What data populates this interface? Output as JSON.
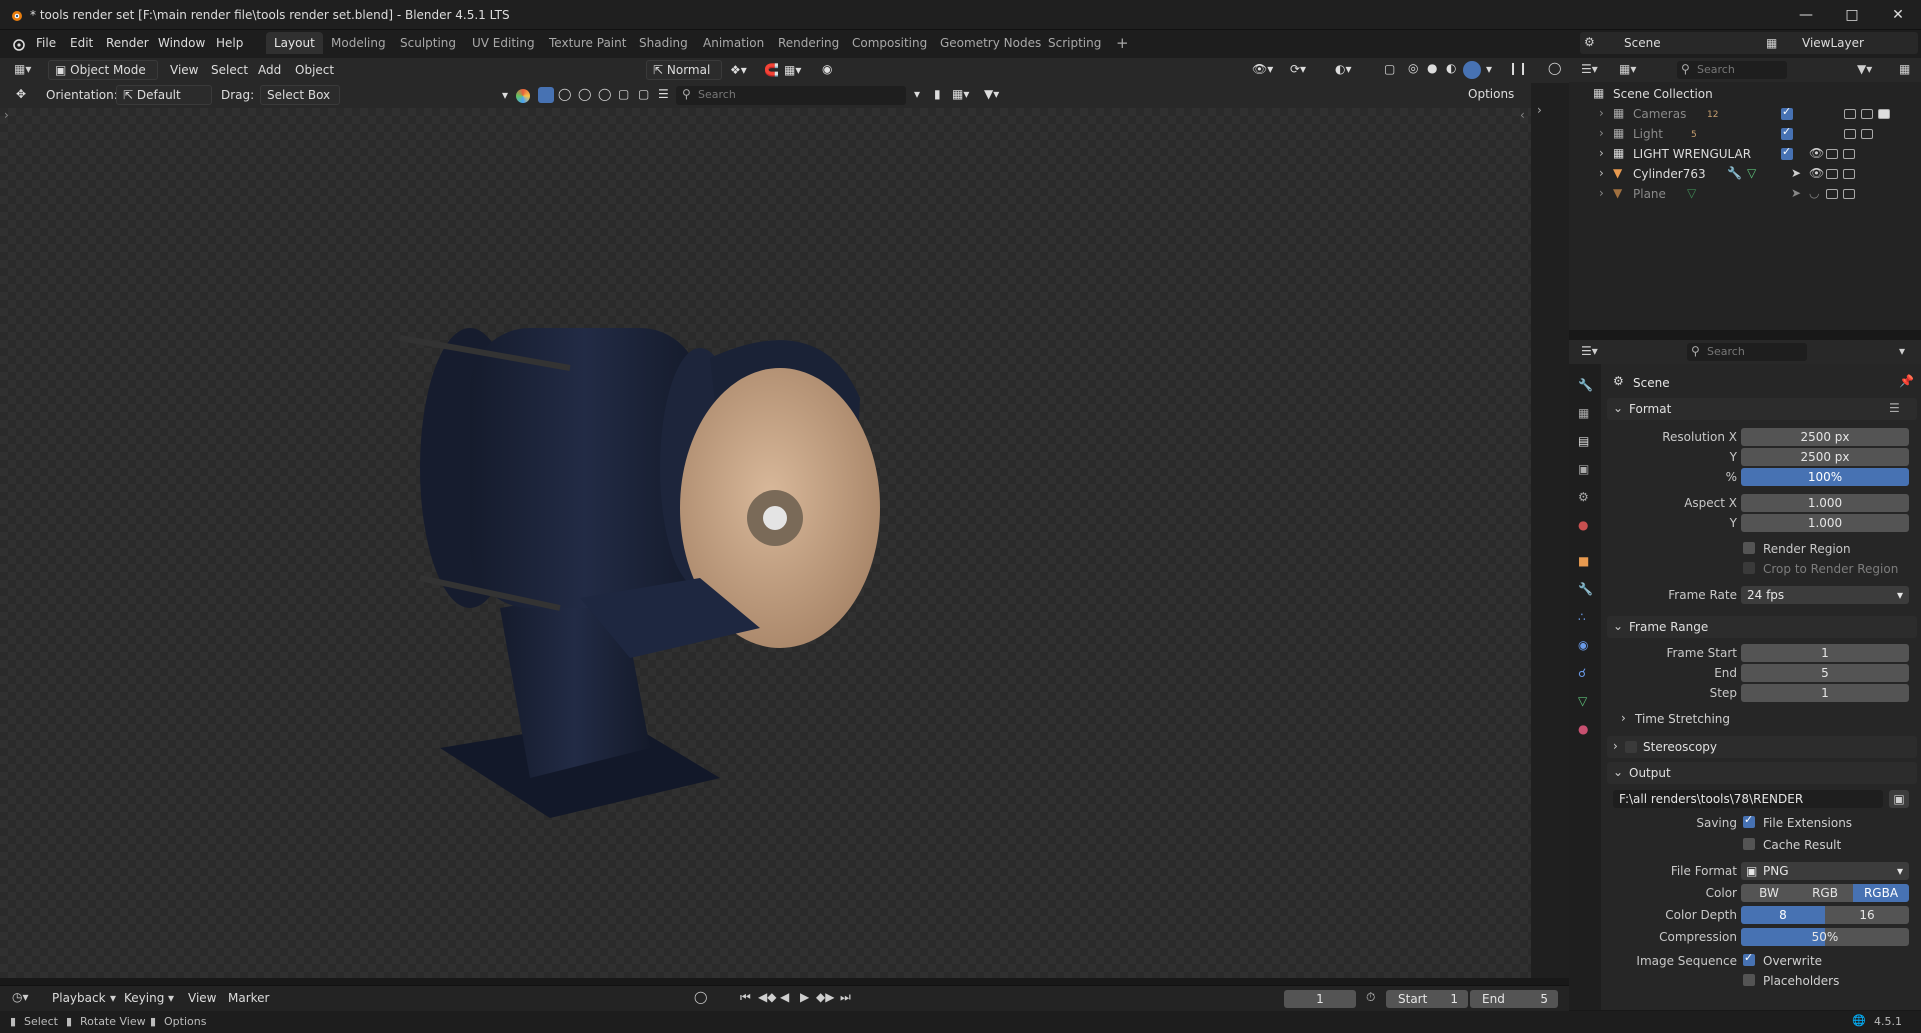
{
  "window": {
    "title": "* tools render set [F:\\main render file\\tools render set.blend] - Blender 4.5.1 LTS"
  },
  "menu": [
    "File",
    "Edit",
    "Render",
    "Window",
    "Help"
  ],
  "workspace_tabs": [
    "Layout",
    "Modeling",
    "Sculpting",
    "UV Editing",
    "Texture Paint",
    "Shading",
    "Animation",
    "Rendering",
    "Compositing",
    "Geometry Nodes",
    "Scripting"
  ],
  "scene_selector": {
    "scene": "Scene",
    "view_layer": "ViewLayer"
  },
  "viewport_header": {
    "mode": "Object Mode",
    "menus": [
      "View",
      "Select",
      "Add",
      "Object"
    ],
    "transform_orientation": "Normal",
    "orientation_label": "Orientation:",
    "orientation_value": "Default",
    "drag_label": "Drag:",
    "drag_value": "Select Box",
    "search_placeholder": "Search",
    "options_label": "Options"
  },
  "outliner": {
    "search_placeholder": "Search",
    "root": "Scene Collection",
    "items": [
      {
        "name": "Cameras",
        "badge": "12",
        "dim": true
      },
      {
        "name": "Light",
        "badge": "5",
        "dim": true
      },
      {
        "name": "LIGHT WRENGULAR",
        "badge": "",
        "dim": false
      },
      {
        "name": "Cylinder763",
        "badge": "",
        "dim": false
      },
      {
        "name": "Plane",
        "badge": "",
        "dim": true
      }
    ]
  },
  "properties": {
    "search_placeholder": "Search",
    "context": "Scene",
    "format": {
      "title": "Format",
      "resolution_x_label": "Resolution X",
      "resolution_x": "2500 px",
      "resolution_y_label": "Y",
      "resolution_y": "2500 px",
      "percent_label": "%",
      "percent": "100%",
      "aspect_x_label": "Aspect X",
      "aspect_x": "1.000",
      "aspect_y_label": "Y",
      "aspect_y": "1.000",
      "render_region": "Render Region",
      "crop_region": "Crop to Render Region",
      "frame_rate_label": "Frame Rate",
      "frame_rate": "24 fps"
    },
    "frame_range": {
      "title": "Frame Range",
      "start_label": "Frame Start",
      "start": "1",
      "end_label": "End",
      "end": "5",
      "step_label": "Step",
      "step": "1",
      "time_stretching": "Time Stretching"
    },
    "stereoscopy": "Stereoscopy",
    "output": {
      "title": "Output",
      "path": "F:\\all renders\\tools\\78\\RENDER",
      "saving_label": "Saving",
      "file_extensions": "File Extensions",
      "cache_result": "Cache Result",
      "file_format_label": "File Format",
      "file_format": "PNG",
      "color_label": "Color",
      "color_options": [
        "BW",
        "RGB",
        "RGBA"
      ],
      "color_depth_label": "Color Depth",
      "color_depth_options": [
        "8",
        "16"
      ],
      "compression_label": "Compression",
      "compression": "50%",
      "image_sequence_label": "Image Sequence",
      "overwrite": "Overwrite",
      "placeholders": "Placeholders"
    }
  },
  "timeline": {
    "menus": [
      "Playback",
      "Keying",
      "View",
      "Marker"
    ],
    "current_frame": "1",
    "start_label": "Start",
    "start": "1",
    "end_label": "End",
    "end": "5"
  },
  "statusbar": {
    "items": [
      "Select",
      "Rotate View",
      "Options"
    ],
    "version": "4.5.1"
  },
  "colors": {
    "accent": "#4772b3",
    "panel": "#262626",
    "header": "#282828"
  }
}
